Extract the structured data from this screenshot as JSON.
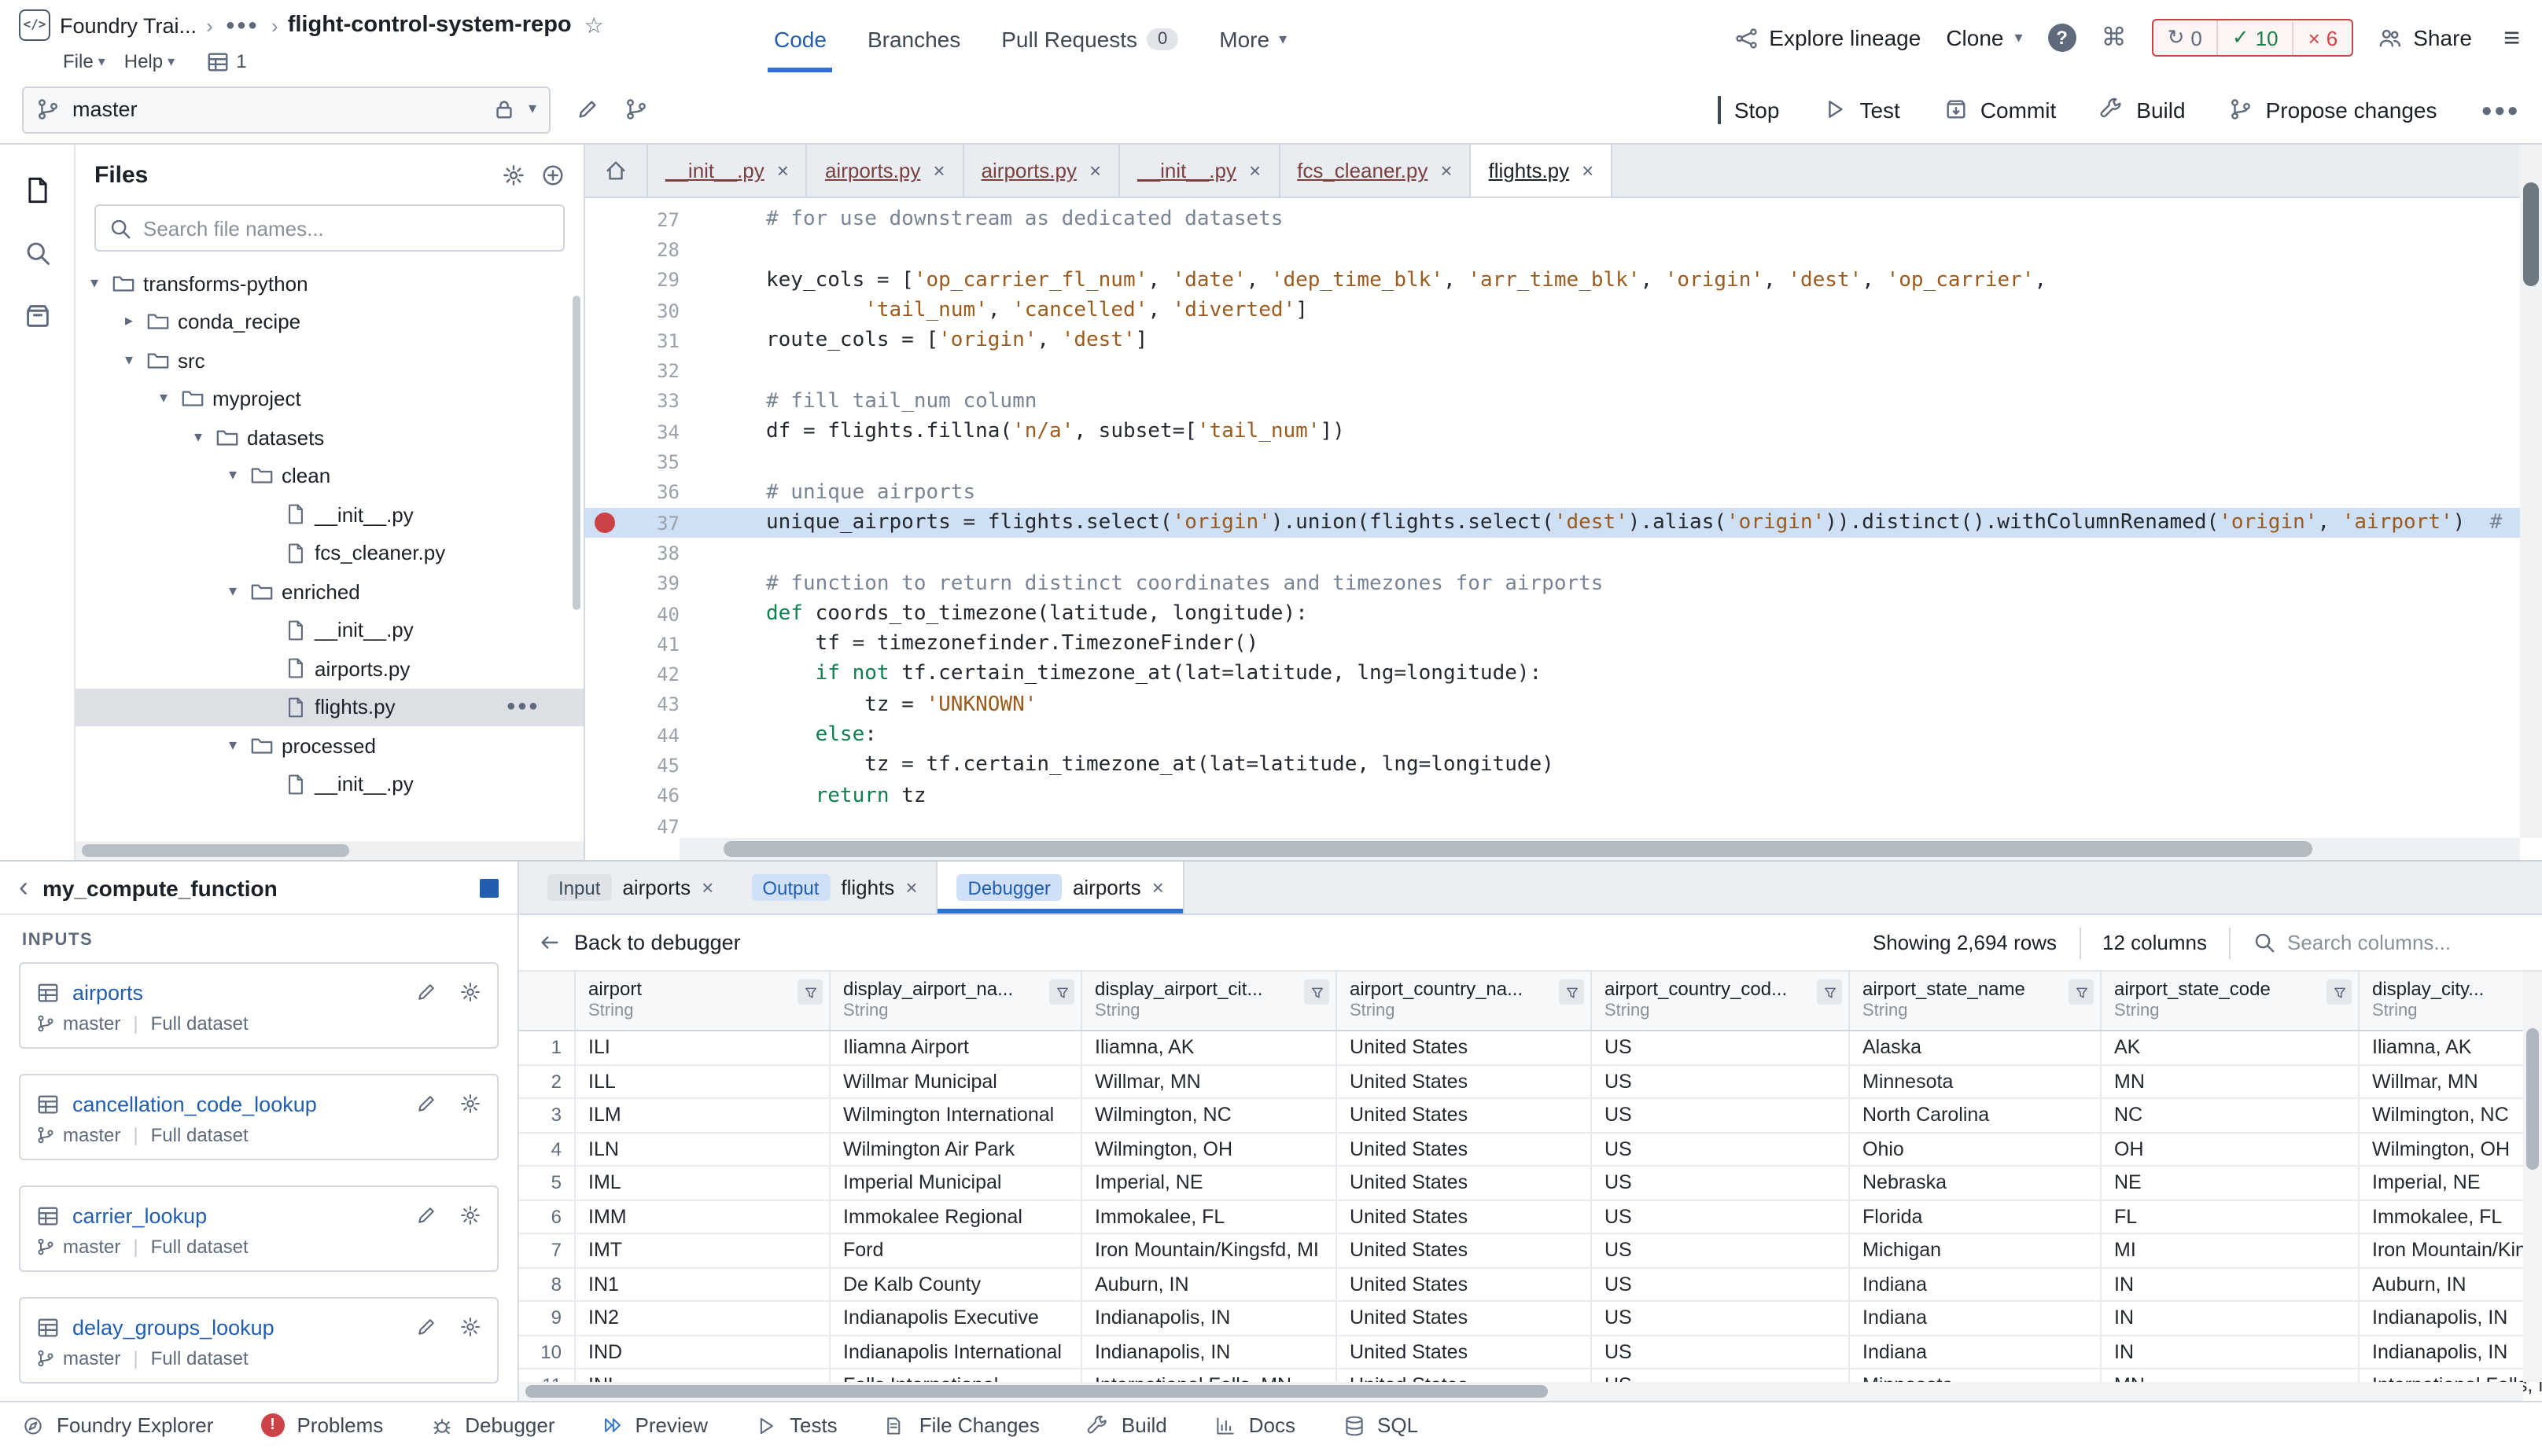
{
  "header": {
    "breadcrumb_root": "Foundry Trai...",
    "repo_name": "flight-control-system-repo",
    "menus": {
      "file": "File",
      "help": "Help",
      "window_count": "1"
    },
    "tabs": [
      {
        "label": "Code",
        "active": true
      },
      {
        "label": "Branches"
      },
      {
        "label": "Pull Requests",
        "badge": "0"
      },
      {
        "label": "More",
        "caret": true
      }
    ],
    "actions": {
      "explore_lineage": "Explore lineage",
      "clone": "Clone",
      "share": "Share"
    },
    "checks": {
      "running": "0",
      "passed": "10",
      "failed": "6"
    }
  },
  "toolbar": {
    "branch": "master",
    "buttons": [
      {
        "label": "Stop",
        "icon": "stop"
      },
      {
        "label": "Test",
        "icon": "play"
      },
      {
        "label": "Commit",
        "icon": "commit"
      },
      {
        "label": "Build",
        "icon": "wrench"
      },
      {
        "label": "Propose changes",
        "icon": "propose"
      }
    ]
  },
  "files_panel": {
    "title": "Files",
    "search_placeholder": "Search file names...",
    "tree": [
      {
        "label": "transforms-python",
        "type": "folder",
        "depth": 0,
        "expanded": true
      },
      {
        "label": "conda_recipe",
        "type": "folder",
        "depth": 1,
        "expanded": false
      },
      {
        "label": "src",
        "type": "folder",
        "depth": 1,
        "expanded": true
      },
      {
        "label": "myproject",
        "type": "folder",
        "depth": 2,
        "expanded": true
      },
      {
        "label": "datasets",
        "type": "folder",
        "depth": 3,
        "expanded": true
      },
      {
        "label": "clean",
        "type": "folder",
        "depth": 4,
        "expanded": true
      },
      {
        "label": "__init__.py",
        "type": "file",
        "depth": 5
      },
      {
        "label": "fcs_cleaner.py",
        "type": "file",
        "depth": 5
      },
      {
        "label": "enriched",
        "type": "folder",
        "depth": 4,
        "expanded": true
      },
      {
        "label": "__init__.py",
        "type": "file",
        "depth": 5
      },
      {
        "label": "airports.py",
        "type": "file",
        "depth": 5
      },
      {
        "label": "flights.py",
        "type": "file",
        "depth": 5,
        "selected": true,
        "menu": true
      },
      {
        "label": "processed",
        "type": "folder",
        "depth": 4,
        "expanded": true
      },
      {
        "label": "__init__.py",
        "type": "file",
        "depth": 5
      }
    ]
  },
  "editor": {
    "tabs": [
      {
        "label": "__init__.py"
      },
      {
        "label": "airports.py"
      },
      {
        "label": "airports.py"
      },
      {
        "label": "__init__.py"
      },
      {
        "label": "fcs_cleaner.py"
      },
      {
        "label": "flights.py",
        "active": true
      }
    ],
    "lines": [
      {
        "n": 27,
        "seg": [
          [
            "c",
            "# for use downstream as dedicated datasets"
          ]
        ]
      },
      {
        "n": 28,
        "seg": []
      },
      {
        "n": 29,
        "seg": [
          [
            "p",
            "key_cols = ["
          ],
          [
            "s",
            "'op_carrier_fl_num'"
          ],
          [
            "p",
            ", "
          ],
          [
            "s",
            "'date'"
          ],
          [
            "p",
            ", "
          ],
          [
            "s",
            "'dep_time_blk'"
          ],
          [
            "p",
            ", "
          ],
          [
            "s",
            "'arr_time_blk'"
          ],
          [
            "p",
            ", "
          ],
          [
            "s",
            "'origin'"
          ],
          [
            "p",
            ", "
          ],
          [
            "s",
            "'dest'"
          ],
          [
            "p",
            ", "
          ],
          [
            "s",
            "'op_carrier'"
          ],
          [
            "p",
            ","
          ]
        ]
      },
      {
        "n": 30,
        "seg": [
          [
            "p",
            "        "
          ],
          [
            "s",
            "'tail_num'"
          ],
          [
            "p",
            ", "
          ],
          [
            "s",
            "'cancelled'"
          ],
          [
            "p",
            ", "
          ],
          [
            "s",
            "'diverted'"
          ],
          [
            "p",
            "]"
          ]
        ]
      },
      {
        "n": 31,
        "seg": [
          [
            "p",
            "route_cols = ["
          ],
          [
            "s",
            "'origin'"
          ],
          [
            "p",
            ", "
          ],
          [
            "s",
            "'dest'"
          ],
          [
            "p",
            "]"
          ]
        ]
      },
      {
        "n": 32,
        "seg": []
      },
      {
        "n": 33,
        "seg": [
          [
            "c",
            "# fill tail_num column"
          ]
        ]
      },
      {
        "n": 34,
        "seg": [
          [
            "p",
            "df = flights.fillna("
          ],
          [
            "s",
            "'n/a'"
          ],
          [
            "p",
            ", subset=["
          ],
          [
            "s",
            "'tail_num'"
          ],
          [
            "p",
            "])"
          ]
        ]
      },
      {
        "n": 35,
        "seg": []
      },
      {
        "n": 36,
        "seg": [
          [
            "c",
            "# unique airports"
          ]
        ]
      },
      {
        "n": 37,
        "breakpoint": true,
        "highlight": true,
        "seg": [
          [
            "p",
            "unique_airports = flights.select("
          ],
          [
            "s",
            "'origin'"
          ],
          [
            "p",
            ").union(flights.select("
          ],
          [
            "s",
            "'dest'"
          ],
          [
            "p",
            ").alias("
          ],
          [
            "s",
            "'origin'"
          ],
          [
            "p",
            ")).distinct().withColumnRenamed("
          ],
          [
            "s",
            "'origin'"
          ],
          [
            "p",
            ", "
          ],
          [
            "s",
            "'airport'"
          ],
          [
            "p",
            ")  "
          ],
          [
            "c",
            "#"
          ]
        ]
      },
      {
        "n": 38,
        "seg": []
      },
      {
        "n": 39,
        "seg": [
          [
            "c",
            "# function to return distinct coordinates and timezones for airports"
          ]
        ]
      },
      {
        "n": 40,
        "seg": [
          [
            "k",
            "def"
          ],
          [
            "p",
            " coords_to_timezone(latitude, longitude):"
          ]
        ]
      },
      {
        "n": 41,
        "seg": [
          [
            "p",
            "    tf = timezonefinder.TimezoneFinder()"
          ]
        ]
      },
      {
        "n": 42,
        "seg": [
          [
            "p",
            "    "
          ],
          [
            "k",
            "if"
          ],
          [
            "p",
            " "
          ],
          [
            "k",
            "not"
          ],
          [
            "p",
            " tf.certain_timezone_at(lat=latitude, lng=longitude):"
          ]
        ]
      },
      {
        "n": 43,
        "seg": [
          [
            "p",
            "        tz = "
          ],
          [
            "s",
            "'UNKNOWN'"
          ]
        ]
      },
      {
        "n": 44,
        "seg": [
          [
            "p",
            "    "
          ],
          [
            "k",
            "else"
          ],
          [
            "p",
            ":"
          ]
        ]
      },
      {
        "n": 45,
        "seg": [
          [
            "p",
            "        tz = tf.certain_timezone_at(lat=latitude, lng=longitude)"
          ]
        ]
      },
      {
        "n": 46,
        "seg": [
          [
            "p",
            "    "
          ],
          [
            "k",
            "return"
          ],
          [
            "p",
            " tz"
          ]
        ]
      },
      {
        "n": 47,
        "seg": []
      }
    ]
  },
  "compute_panel": {
    "title": "my_compute_function",
    "section_label": "INPUTS",
    "inputs": [
      {
        "name": "airports",
        "branch": "master",
        "mode": "Full dataset"
      },
      {
        "name": "cancellation_code_lookup",
        "branch": "master",
        "mode": "Full dataset"
      },
      {
        "name": "carrier_lookup",
        "branch": "master",
        "mode": "Full dataset"
      },
      {
        "name": "delay_groups_lookup",
        "branch": "master",
        "mode": "Full dataset"
      }
    ]
  },
  "results": {
    "tabs": [
      {
        "chip": "Input",
        "chip_style": "gray",
        "label": "airports"
      },
      {
        "chip": "Output",
        "chip_style": "blue",
        "label": "flights"
      },
      {
        "chip": "Debugger",
        "chip_style": "blue",
        "label": "airports",
        "active": true
      }
    ],
    "toolbar": {
      "back_label": "Back to debugger",
      "rows_info": "Showing 2,694 rows",
      "columns_info": "12 columns",
      "search_placeholder": "Search columns..."
    },
    "table": {
      "columns": [
        {
          "name": "airport",
          "type": "String"
        },
        {
          "name": "display_airport_na...",
          "type": "String"
        },
        {
          "name": "display_airport_cit...",
          "type": "String"
        },
        {
          "name": "airport_country_na...",
          "type": "String"
        },
        {
          "name": "airport_country_cod...",
          "type": "String"
        },
        {
          "name": "airport_state_name",
          "type": "String"
        },
        {
          "name": "airport_state_code",
          "type": "String"
        },
        {
          "name": "display_city...",
          "type": "String"
        }
      ],
      "rows": [
        [
          "ILI",
          "Iliamna Airport",
          "Iliamna, AK",
          "United States",
          "US",
          "Alaska",
          "AK",
          "Iliamna, AK"
        ],
        [
          "ILL",
          "Willmar Municipal",
          "Willmar, MN",
          "United States",
          "US",
          "Minnesota",
          "MN",
          "Willmar, MN"
        ],
        [
          "ILM",
          "Wilmington International",
          "Wilmington, NC",
          "United States",
          "US",
          "North Carolina",
          "NC",
          "Wilmington, NC"
        ],
        [
          "ILN",
          "Wilmington Air Park",
          "Wilmington, OH",
          "United States",
          "US",
          "Ohio",
          "OH",
          "Wilmington, OH"
        ],
        [
          "IML",
          "Imperial Municipal",
          "Imperial, NE",
          "United States",
          "US",
          "Nebraska",
          "NE",
          "Imperial, NE"
        ],
        [
          "IMM",
          "Immokalee Regional",
          "Immokalee, FL",
          "United States",
          "US",
          "Florida",
          "FL",
          "Immokalee, FL"
        ],
        [
          "IMT",
          "Ford",
          "Iron Mountain/Kingsfd, MI",
          "United States",
          "US",
          "Michigan",
          "MI",
          "Iron Mountain/Kingsfd, MI"
        ],
        [
          "IN1",
          "De Kalb County",
          "Auburn, IN",
          "United States",
          "US",
          "Indiana",
          "IN",
          "Auburn, IN"
        ],
        [
          "IN2",
          "Indianapolis Executive",
          "Indianapolis, IN",
          "United States",
          "US",
          "Indiana",
          "IN",
          "Indianapolis, IN"
        ],
        [
          "IND",
          "Indianapolis International",
          "Indianapolis, IN",
          "United States",
          "US",
          "Indiana",
          "IN",
          "Indianapolis, IN"
        ],
        [
          "INL",
          "Falls International",
          "International Falls, MN",
          "United States",
          "US",
          "Minnesota",
          "MN",
          "International Falls, MN"
        ]
      ]
    }
  },
  "statusbar": {
    "items": [
      {
        "label": "Foundry Explorer",
        "icon": "compass"
      },
      {
        "label": "Problems",
        "icon": "error"
      },
      {
        "label": "Debugger",
        "icon": "bug"
      },
      {
        "label": "Preview",
        "icon": "play2"
      },
      {
        "label": "Tests",
        "icon": "play"
      },
      {
        "label": "File Changes",
        "icon": "diff"
      },
      {
        "label": "Build",
        "icon": "wrench"
      },
      {
        "label": "Docs",
        "icon": "chart"
      },
      {
        "label": "SQL",
        "icon": "db"
      }
    ]
  },
  "colors": {
    "accent": "#2d72d2",
    "link": "#215db0",
    "success": "#1c8149",
    "danger": "#cd4246"
  }
}
